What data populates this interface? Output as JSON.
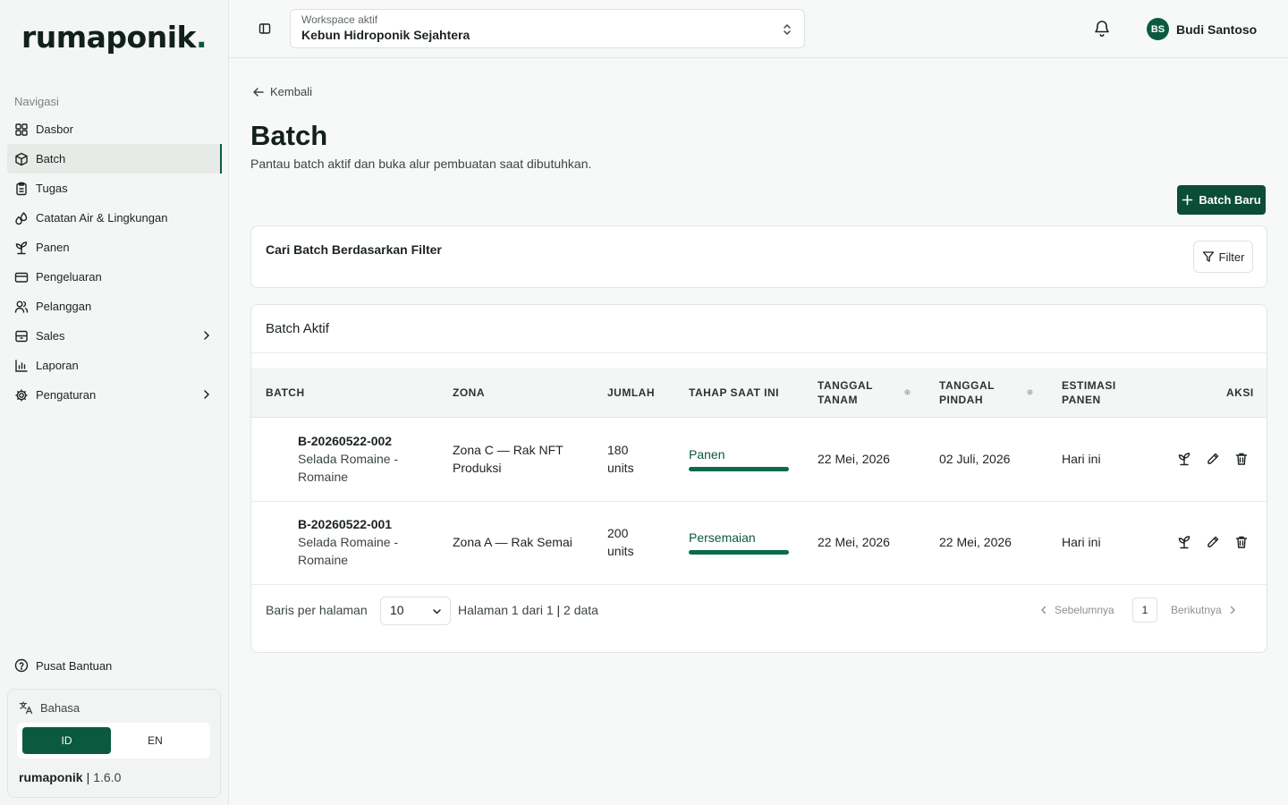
{
  "app": {
    "logo_main": "rumaponik",
    "logo_dot": "."
  },
  "sidebar": {
    "heading": "Navigasi",
    "items": [
      {
        "label": "Dasbor",
        "icon": "grid-icon"
      },
      {
        "label": "Batch",
        "icon": "box-icon",
        "active": true
      },
      {
        "label": "Tugas",
        "icon": "clipboard-icon"
      },
      {
        "label": "Catatan Air & Lingkungan",
        "icon": "droplets-icon"
      },
      {
        "label": "Panen",
        "icon": "sprout-icon"
      },
      {
        "label": "Pengeluaran",
        "icon": "credit-card-icon"
      },
      {
        "label": "Pelanggan",
        "icon": "users-icon"
      },
      {
        "label": "Sales",
        "icon": "archive-icon"
      },
      {
        "label": "Laporan",
        "icon": "bar-chart-icon"
      },
      {
        "label": "Pengaturan",
        "icon": "gear-icon"
      }
    ],
    "help": "Pusat Bantuan",
    "language": {
      "title": "Bahasa",
      "options": [
        "ID",
        "EN"
      ],
      "selected": "ID"
    },
    "version": {
      "brand": "rumaponik",
      "number": "1.6.0"
    }
  },
  "topbar": {
    "workspace_label": "Workspace aktif",
    "workspace_value": "Kebun Hidroponik Sejahtera",
    "user_initials": "BS",
    "user_name": "Budi Santoso"
  },
  "page": {
    "back": "Kembali",
    "title": "Batch",
    "subtitle": "Pantau batch aktif dan buka alur pembuatan saat dibutuhkan.",
    "new_button": "Batch Baru"
  },
  "filter": {
    "title": "Cari Batch Berdasarkan Filter",
    "button": "Filter"
  },
  "table": {
    "title": "Batch Aktif",
    "headers": {
      "batch": "BATCH",
      "zona": "ZONA",
      "jumlah": "JUMLAH",
      "tahap": "TAHAP SAAT INI",
      "tanam_1": "TANGGAL",
      "tanam_2": "TANAM",
      "pindah_1": "TANGGAL",
      "pindah_2": "PINDAH",
      "estimasi_1": "ESTIMASI",
      "estimasi_2": "PANEN",
      "aksi": "AKSI"
    },
    "rows": [
      {
        "id": "B-20260522-002",
        "crop_1": "Selada Romaine -",
        "crop_2": "Romaine",
        "zona_1": "Zona C — Rak NFT",
        "zona_2": "Produksi",
        "jumlah_1": "180",
        "jumlah_2": "units",
        "tahap": "Panen",
        "tanam": "22 Mei, 2026",
        "pindah": "02 Juli, 2026",
        "estimasi": "Hari ini"
      },
      {
        "id": "B-20260522-001",
        "crop_1": "Selada Romaine -",
        "crop_2": "Romaine",
        "zona_1": "Zona A — Rak Semai",
        "zona_2": "",
        "jumlah_1": "200",
        "jumlah_2": "units",
        "tahap": "Persemaian",
        "tanam": "22 Mei, 2026",
        "pindah": "22 Mei, 2026",
        "estimasi": "Hari ini"
      }
    ]
  },
  "pagination": {
    "rows_label": "Baris per halaman",
    "rows_value": "10",
    "page_info": "Halaman 1 dari 1",
    "separator": "|",
    "count": "2 data",
    "prev": "Sebelumnya",
    "current": "1",
    "next": "Berikutnya"
  }
}
